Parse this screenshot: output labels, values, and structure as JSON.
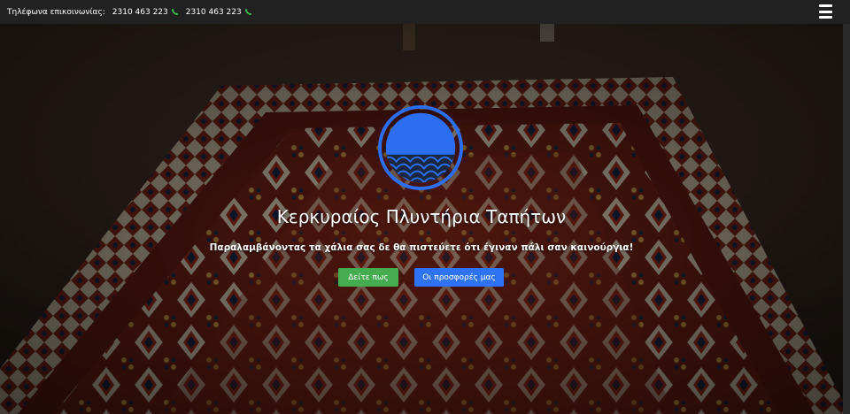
{
  "topbar": {
    "contact_label": "Τηλέφωνα επικοινωνίας:",
    "phones": [
      "2310 463 223",
      "2310 463 223"
    ],
    "phone_icon": "phone-icon",
    "menu_icon": "hamburger-menu-icon"
  },
  "hero": {
    "title": "Κερκυραίος Πλυντήρια Ταπήτων",
    "subtitle": "Παραλαμβάνοντας τα χάλια σας δε θα πιστεύετε ότι έγιναν πάλι σαν καινούργια!",
    "buttons": {
      "primary": "Δείτε πως",
      "secondary": "Οι προσφορές μας"
    }
  },
  "colors": {
    "topbar_bg": "#212121",
    "primary_button": "#45ad4f",
    "secondary_button": "#2f73f5",
    "logo_blue": "#2b6ff0",
    "phone_icon": "#3fbf4f"
  }
}
